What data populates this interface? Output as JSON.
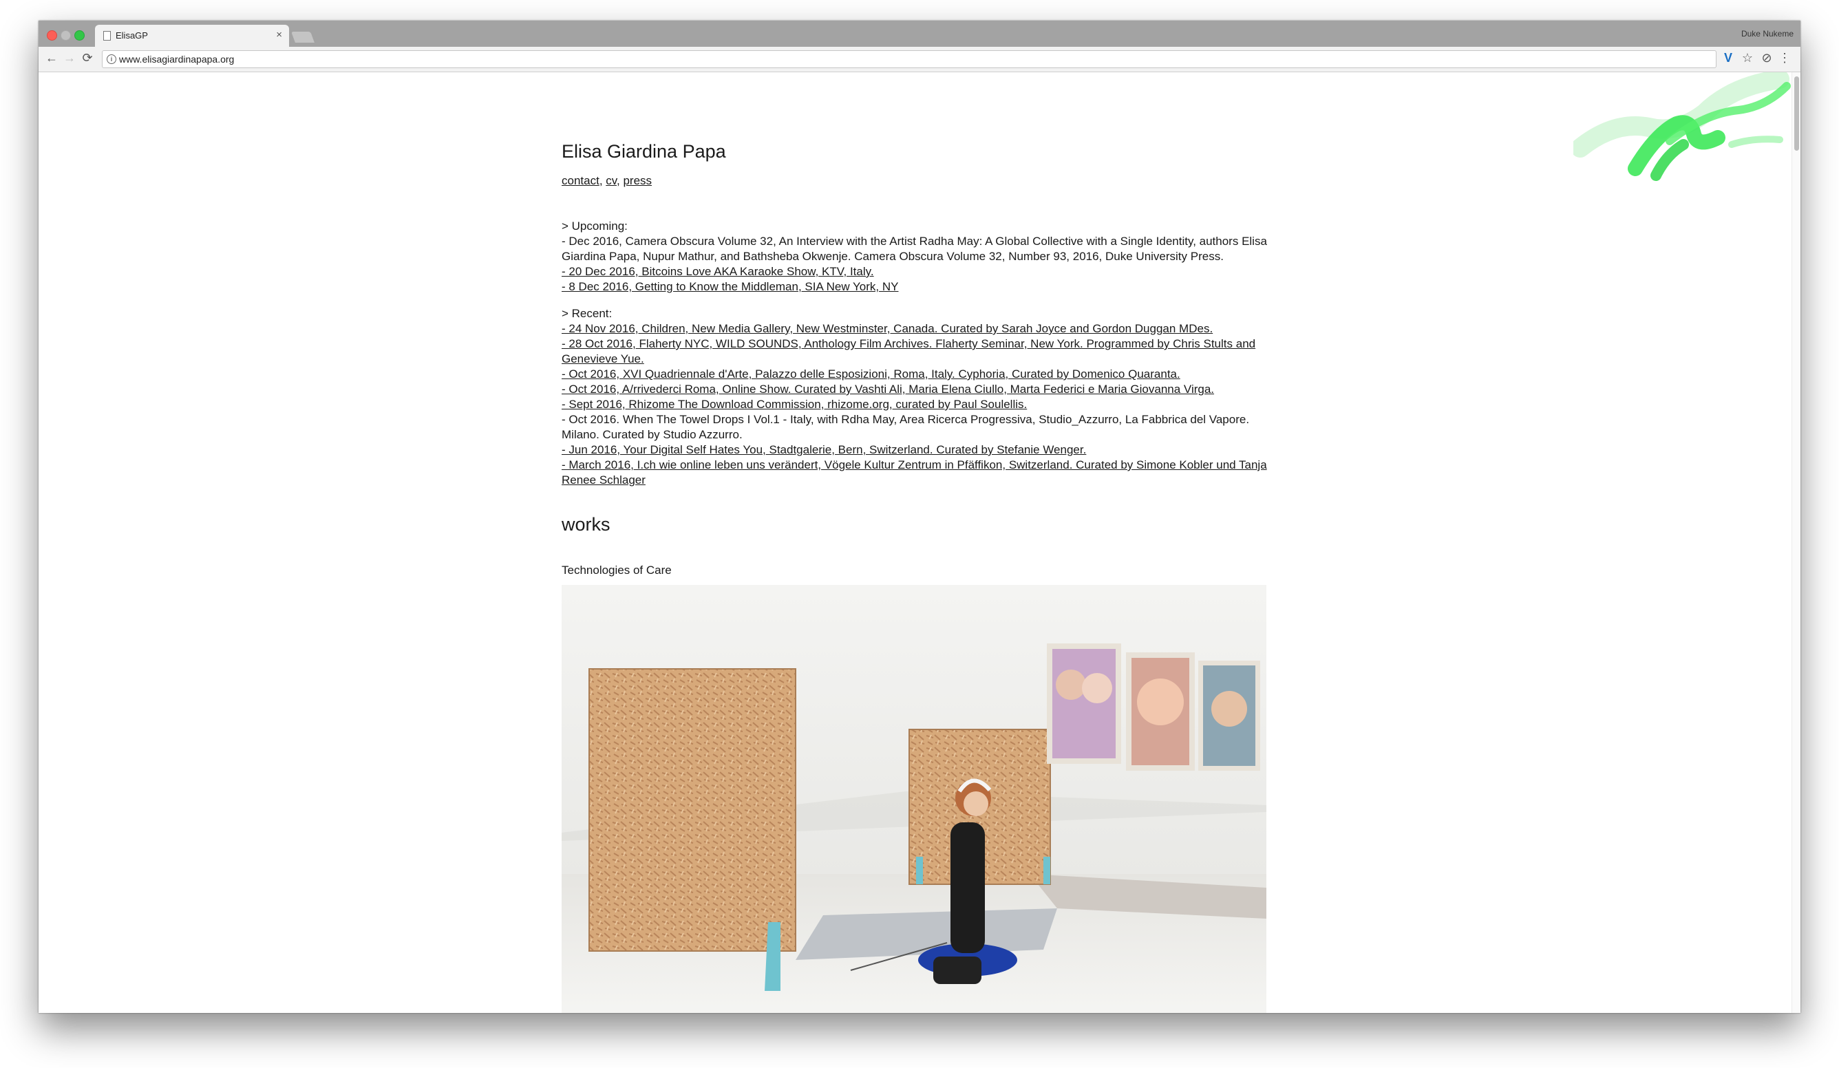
{
  "browser": {
    "tab_title": "ElisaGP",
    "tab_close": "×",
    "profile_name": "Duke Nukeme",
    "url": "www.elisagiardinapapa.org",
    "nav": {
      "back": "←",
      "forward": "→",
      "reload": "⟳"
    },
    "extensions": {
      "v": "V",
      "star": "☆",
      "circle": "⊘",
      "menu": "⋮"
    },
    "info_icon": "i"
  },
  "page": {
    "title": "Elisa Giardina Papa",
    "links": {
      "contact": "contact",
      "sep1": ", ",
      "cv": "cv",
      "sep2": ", ",
      "press": "press"
    },
    "upcoming": {
      "heading": "> Upcoming:",
      "items": [
        {
          "text": "- Dec 2016, Camera Obscura Volume 32, An Interview with the Artist Radha May: A Global Collective with a Single Identity, authors Elisa Giardina Papa, Nupur Mathur, and Bathsheba Okwenje. Camera Obscura Volume 32, Number 93, 2016, Duke University Press.",
          "link": false
        },
        {
          "text": "- 20 Dec 2016, Bitcoins Love AKA Karaoke Show, KTV, Italy.",
          "link": true
        },
        {
          "text": "- 8 Dec 2016, Getting to Know the Middleman, SIA New York, NY",
          "link": true
        }
      ]
    },
    "recent": {
      "heading": "> Recent:",
      "items": [
        {
          "text": "- 24 Nov 2016, Children, New Media Gallery, New Westminster, Canada. Curated by Sarah Joyce and Gordon Duggan MDes.",
          "link": true
        },
        {
          "text": "- 28 Oct 2016, Flaherty NYC, WILD SOUNDS, Anthology Film Archives. Flaherty Seminar, New York. Programmed by Chris Stults and Genevieve Yue.",
          "link": true
        },
        {
          "text": "- Oct 2016, XVI Quadriennale d'Arte, Palazzo delle Esposizioni, Roma, Italy. Cyphoria, Curated by Domenico Quaranta.",
          "link": true
        },
        {
          "text": "- Oct 2016, A/rrivederci Roma, Online Show. Curated by Vashti Ali, Maria Elena Ciullo, Marta Federici e Maria Giovanna Virga.",
          "link": true
        },
        {
          "text": "- Sept 2016, Rhizome The Download Commission, rhizome.org, curated by Paul Soulellis.",
          "link": true
        },
        {
          "text": "- Oct 2016. When The Towel Drops I Vol.1 - Italy, with Rdha May, Area Ricerca Progressiva, Studio_Azzurro, La Fabbrica del Vapore. Milano. Curated by Studio Azzurro.",
          "link": false
        },
        {
          "text": "- Jun 2016, Your Digital Self Hates You, Stadtgalerie, Bern, Switzerland. Curated by Stefanie Wenger.",
          "link": true
        },
        {
          "text": "- March 2016, I.ch    wie online leben uns verändert, Vögele Kultur Zentrum in Pfäffikon, Switzerland. Curated by Simone Kobler und Tanja Renee Schlager",
          "link": true
        }
      ]
    },
    "works_heading": "works",
    "work_title": "Technologies of Care"
  },
  "colors": {
    "chrome_tabstrip": "#a3a3a3",
    "chrome_toolbar": "#f2f2f2",
    "text": "#1a1a1a",
    "brush_green": "#3ee85a"
  }
}
